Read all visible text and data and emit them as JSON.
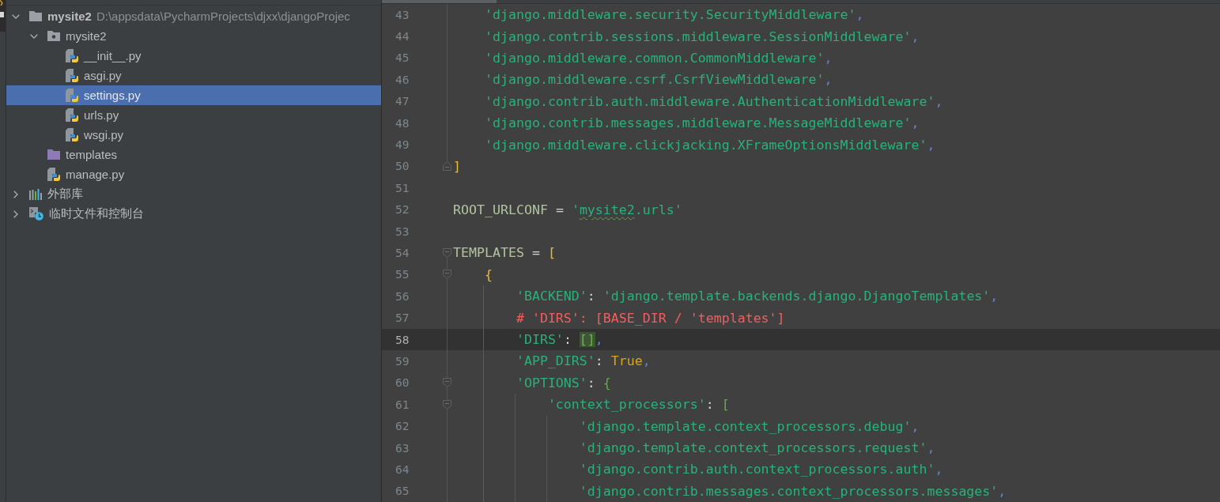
{
  "project_tree": {
    "items": [
      {
        "label": "mysite2",
        "path": "D:\\appsdata\\PycharmProjects\\djxx\\djangoProjec",
        "kind": "project",
        "expanded": true,
        "selected": false,
        "children": [
          {
            "label": "mysite2",
            "kind": "package",
            "expanded": true,
            "selected": false,
            "children": [
              {
                "label": "__init__.py",
                "kind": "python",
                "selected": false
              },
              {
                "label": "asgi.py",
                "kind": "python",
                "selected": false
              },
              {
                "label": "settings.py",
                "kind": "python",
                "selected": true
              },
              {
                "label": "urls.py",
                "kind": "python",
                "selected": false
              },
              {
                "label": "wsgi.py",
                "kind": "python",
                "selected": false
              }
            ]
          },
          {
            "label": "templates",
            "kind": "template-folder",
            "selected": false
          },
          {
            "label": "manage.py",
            "kind": "python",
            "selected": false
          }
        ]
      },
      {
        "label": "外部库",
        "kind": "libraries",
        "expanded": false,
        "selected": false
      },
      {
        "label": "临时文件和控制台",
        "kind": "scratches",
        "expanded": false,
        "selected": false
      }
    ]
  },
  "editor": {
    "lines": [
      {
        "children": [
          {
            "number": "43",
            "current": false,
            "tokens": [
              {
                "text": "'django.middleware.security.SecurityMiddleware'",
                "kind": "string"
              },
              {
                "text": ",",
                "kind": "comma"
              }
            ]
          },
          {
            "number": "44",
            "current": false,
            "tokens": [
              {
                "text": "'django.contrib.sessions.middleware.SessionMiddleware'",
                "kind": "string"
              },
              {
                "text": ",",
                "kind": "comma"
              }
            ]
          },
          {
            "number": "45",
            "current": false,
            "tokens": [
              {
                "text": "'django.middleware.common.CommonMiddleware'",
                "kind": "string"
              },
              {
                "text": ",",
                "kind": "comma"
              }
            ]
          },
          {
            "number": "46",
            "current": false,
            "tokens": [
              {
                "text": "'django.middleware.csrf.CsrfViewMiddleware'",
                "kind": "string"
              },
              {
                "text": ",",
                "kind": "comma"
              }
            ]
          },
          {
            "number": "47",
            "current": false,
            "tokens": [
              {
                "text": "'django.contrib.auth.middleware.AuthenticationMiddleware'",
                "kind": "string"
              },
              {
                "text": ",",
                "kind": "comma"
              }
            ]
          },
          {
            "number": "48",
            "current": false,
            "tokens": [
              {
                "text": "'django.contrib.messages.middleware.MessageMiddleware'",
                "kind": "string"
              },
              {
                "text": ",",
                "kind": "comma"
              }
            ]
          },
          {
            "number": "49",
            "current": false,
            "tokens": [
              {
                "text": "'django.middleware.clickjacking.XFrameOptionsMiddleware'",
                "kind": "string"
              },
              {
                "text": ",",
                "kind": "comma"
              }
            ]
          }
        ],
        "closing": {
          "number": "50",
          "current": false,
          "tokens": [
            {
              "text": "]",
              "kind": "bracket_outer"
            }
          ]
        }
      },
      {
        "number": "51",
        "current": false
      },
      {
        "number": "52",
        "current": false,
        "tokens": [
          {
            "text": "ROOT_URLCONF",
            "kind": "identifier"
          },
          {
            "text": " = ",
            "kind": "operator"
          },
          {
            "text": "'",
            "kind": "string"
          },
          {
            "text": "mysite2",
            "kind": "string_typo"
          },
          {
            "text": ".urls'",
            "kind": "string"
          }
        ]
      },
      {
        "number": "53",
        "current": false
      },
      {
        "number": "54",
        "current": false,
        "tokens": [
          {
            "text": "TEMPLATES",
            "kind": "identifier"
          },
          {
            "text": " = ",
            "kind": "operator"
          },
          {
            "text": "[",
            "kind": "bracket_outer"
          }
        ],
        "children": [
          {
            "number": "55",
            "current": false,
            "tokens": [
              {
                "text": "{",
                "kind": "bracket_outer"
              }
            ],
            "children": [
              {
                "number": "56",
                "current": false,
                "tokens": [
                  {
                    "text": "'BACKEND'",
                    "kind": "string"
                  },
                  {
                    "text": ": ",
                    "kind": "operator"
                  },
                  {
                    "text": "'django.template.backends.django.DjangoTemplates'",
                    "kind": "string"
                  },
                  {
                    "text": ",",
                    "kind": "comma"
                  }
                ]
              },
              {
                "number": "57",
                "current": false,
                "tokens": [
                  {
                    "text": "# 'DIRS': [BASE_DIR / 'templates']",
                    "kind": "comment"
                  }
                ]
              },
              {
                "number": "58",
                "current": true,
                "tokens": [
                  {
                    "text": "'DIRS'",
                    "kind": "string"
                  },
                  {
                    "text": ": ",
                    "kind": "operator"
                  },
                  {
                    "text": "[]",
                    "kind": "bracket_match"
                  },
                  {
                    "text": ",",
                    "kind": "comma"
                  }
                ]
              },
              {
                "number": "59",
                "current": false,
                "tokens": [
                  {
                    "text": "'APP_DIRS'",
                    "kind": "string"
                  },
                  {
                    "text": ": ",
                    "kind": "operator"
                  },
                  {
                    "text": "True",
                    "kind": "keyword"
                  },
                  {
                    "text": ",",
                    "kind": "comma"
                  }
                ]
              },
              {
                "number": "60",
                "current": false,
                "tokens": [
                  {
                    "text": "'OPTIONS'",
                    "kind": "string"
                  },
                  {
                    "text": ": ",
                    "kind": "operator"
                  },
                  {
                    "text": "{",
                    "kind": "bracket_inner"
                  }
                ],
                "children": [
                  {
                    "number": "61",
                    "current": false,
                    "tokens": [
                      {
                        "text": "'context_processors'",
                        "kind": "string"
                      },
                      {
                        "text": ": ",
                        "kind": "operator"
                      },
                      {
                        "text": "[",
                        "kind": "bracket_inner"
                      }
                    ],
                    "children": [
                      {
                        "number": "62",
                        "current": false,
                        "tokens": [
                          {
                            "text": "'django.template.context_processors.debug'",
                            "kind": "string"
                          },
                          {
                            "text": ",",
                            "kind": "comma"
                          }
                        ]
                      },
                      {
                        "number": "63",
                        "current": false,
                        "tokens": [
                          {
                            "text": "'django.template.context_processors.request'",
                            "kind": "string"
                          },
                          {
                            "text": ",",
                            "kind": "comma"
                          }
                        ]
                      },
                      {
                        "number": "64",
                        "current": false,
                        "tokens": [
                          {
                            "text": "'django.contrib.auth.context_processors.auth'",
                            "kind": "string"
                          },
                          {
                            "text": ",",
                            "kind": "comma"
                          }
                        ]
                      },
                      {
                        "number": "65",
                        "current": false,
                        "tokens": [
                          {
                            "text": "'django.contrib.messages.context_processors.messages'",
                            "kind": "string"
                          },
                          {
                            "text": ",",
                            "kind": "comma"
                          }
                        ]
                      }
                    ]
                  }
                ]
              }
            ]
          }
        ]
      }
    ]
  }
}
